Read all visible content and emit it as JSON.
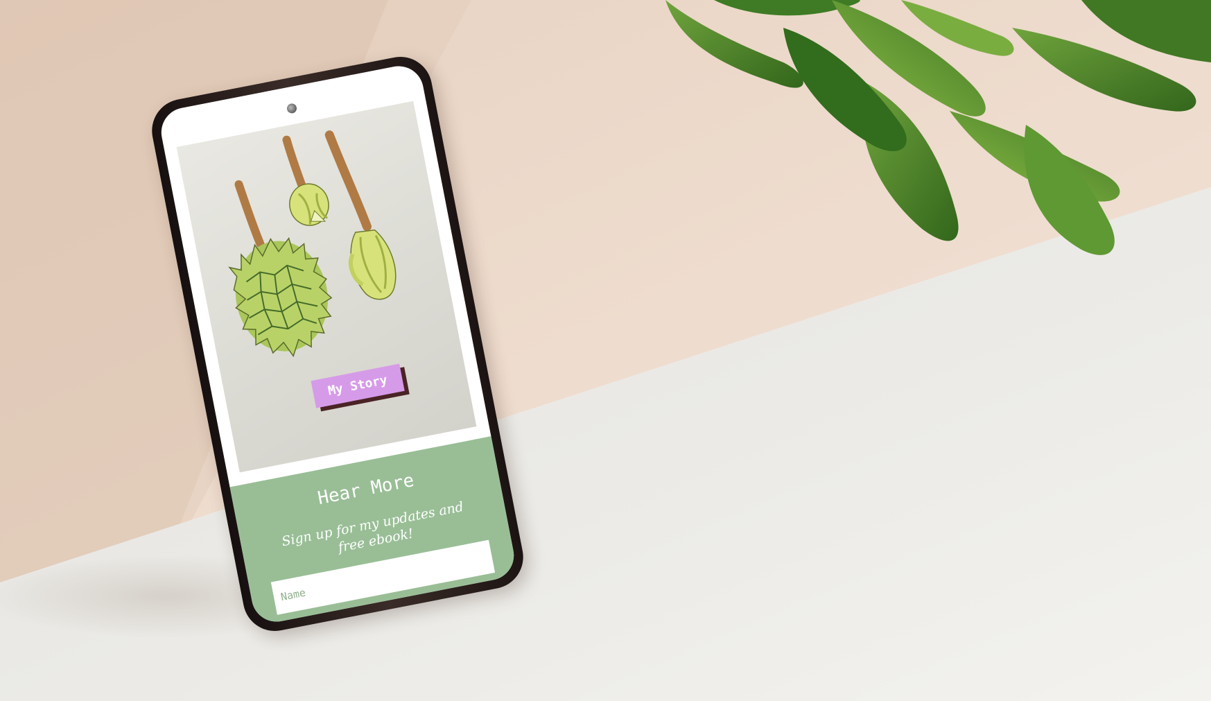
{
  "phone": {
    "hero": {
      "button_label": "My Story"
    },
    "signup": {
      "title": "Hear More",
      "subtitle": "Sign up for my updates and free ebook!",
      "name_placeholder": "Name"
    }
  },
  "colors": {
    "wall": "#ecd9c9",
    "floor": "#ebebea",
    "phone_frame": "#2a1f1d",
    "button_fill": "#d69be8",
    "button_shadow": "#4a2325",
    "signup_green": "#99be96",
    "leaf_green": "#4f8a2c"
  },
  "icons": {
    "camera": "camera-dot-icon"
  }
}
